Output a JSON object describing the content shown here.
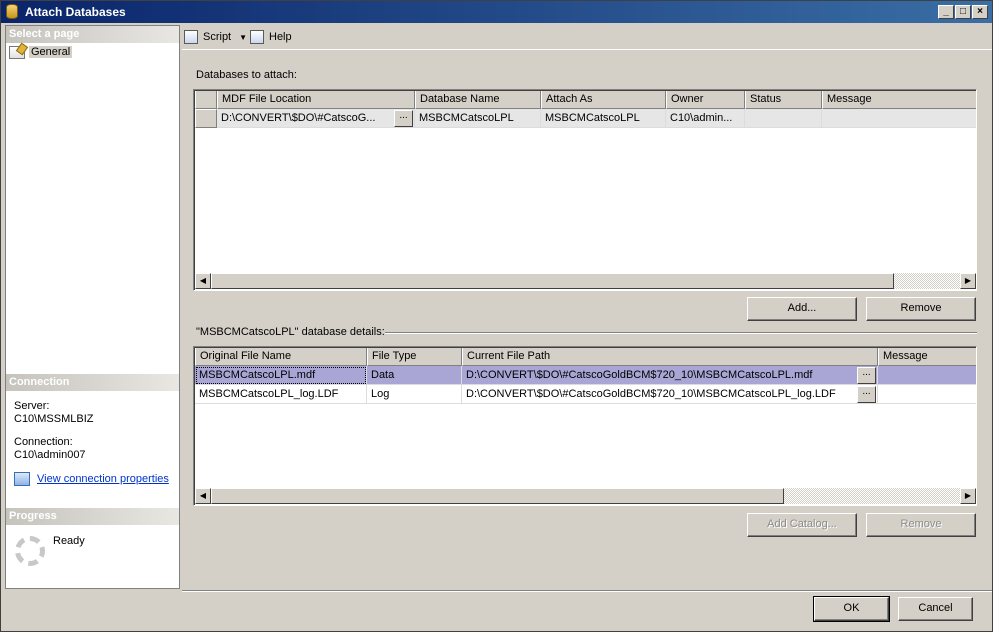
{
  "window": {
    "title": "Attach Databases",
    "controls": [
      "_",
      "□",
      "×"
    ]
  },
  "sidebar": {
    "select_page_header": "Select a page",
    "pages": [
      {
        "label": "General",
        "icon": "page-settings-icon"
      }
    ],
    "connection_header": "Connection",
    "server_label": "Server:",
    "server_value": "C10\\MSSMLBIZ",
    "connection_label": "Connection:",
    "connection_value": "C10\\admin007",
    "view_connection_link": "View connection properties",
    "progress_header": "Progress",
    "progress_status": "Ready"
  },
  "toolbar": {
    "script_label": "Script",
    "help_label": "Help"
  },
  "databases_section": {
    "label": "Databases to attach:",
    "columns": [
      "",
      "MDF File Location",
      "Database Name",
      "Attach As",
      "Owner",
      "Status",
      "Message"
    ],
    "rows": [
      {
        "mdf": "D:\\CONVERT\\$DO\\#CatscoG...",
        "ellipsis": "...",
        "db_name": "MSBCMCatscoLPL",
        "attach_as": "MSBCMCatscoLPL",
        "owner": "C10\\admin...",
        "status": "",
        "message": ""
      }
    ],
    "add_button": "Add...",
    "remove_button": "Remove"
  },
  "details_section": {
    "label": "\"MSBCMCatscoLPL\" database details:",
    "columns": [
      "Original File Name",
      "File Type",
      "Current File Path",
      "Message"
    ],
    "rows": [
      {
        "name": "MSBCMCatscoLPL.mdf",
        "type": "Data",
        "path": "D:\\CONVERT\\$DO\\#CatscoGoldBCM$720_10\\MSBCMCatscoLPL.mdf",
        "ellipsis": "...",
        "message": ""
      },
      {
        "name": "MSBCMCatscoLPL_log.LDF",
        "type": "Log",
        "path": "D:\\CONVERT\\$DO\\#CatscoGoldBCM$720_10\\MSBCMCatscoLPL_log.LDF",
        "ellipsis": "...",
        "message": ""
      }
    ],
    "add_catalog_button": "Add Catalog...",
    "remove_button": "Remove"
  },
  "footer": {
    "ok_button": "OK",
    "cancel_button": "Cancel"
  },
  "colors": {
    "title_bar": "#0a246a",
    "selected_row": "#a9a6d6",
    "link": "#0033cc"
  }
}
